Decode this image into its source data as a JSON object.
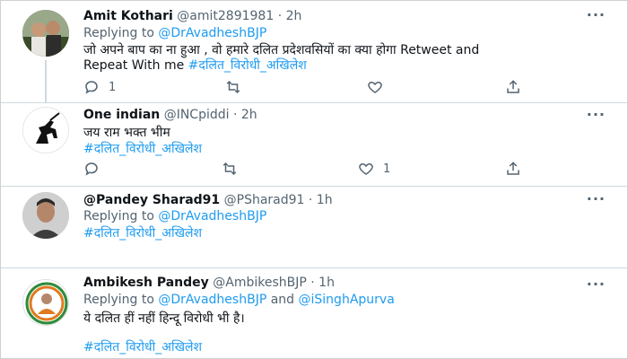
{
  "tweets": [
    {
      "name": "Amit Kothari",
      "handle": "@amit2891981",
      "time": "· 2h",
      "replying_prefix": "Replying to",
      "replying_to": "@DrAvadheshBJP",
      "text_line1": "जो अपने बाप का ना हुआ , वो हमारे दलित प्रदेशवसियों का क्या होगा Retweet and",
      "text_line2_plain": "Repeat With me",
      "text_line2_tag": "#दलित_विरोधी_अखिलेश",
      "reply_count": "1",
      "like_count": ""
    },
    {
      "name": "One indian",
      "handle": "@INCpiddi",
      "time": "· 2h",
      "text_line1": "जय राम भक्त भीम",
      "hashtag": "#दलित_विरोधी_अखिलेश",
      "reply_count": "",
      "like_count": "1"
    },
    {
      "name": "@Pandey Sharad91",
      "handle": "@PSharad91",
      "time": "· 1h",
      "replying_prefix": "Replying to",
      "replying_to": "@DrAvadheshBJP",
      "hashtag": "#दलित_विरोधी_अखिलेश"
    },
    {
      "name": "Ambikesh Pandey",
      "handle": "@AmbikeshBJP",
      "time": "· 1h",
      "replying_prefix": "Replying to",
      "replying_to": "@DrAvadheshBJP",
      "replying_and": "and",
      "replying_to2": "@iSinghApurva",
      "text_line1": "ये दलित हीं नहीं हिन्दू विरोधी भी है।",
      "hashtag": "#दलित_विरोधी_अखिलेश"
    }
  ],
  "icons": {
    "reply": "reply-icon",
    "retweet": "retweet-icon",
    "like": "heart-icon",
    "share": "share-icon",
    "more": "more-icon"
  },
  "colors": {
    "link": "#1d9bf0",
    "muted": "#536471",
    "divider": "#cfd9de"
  }
}
